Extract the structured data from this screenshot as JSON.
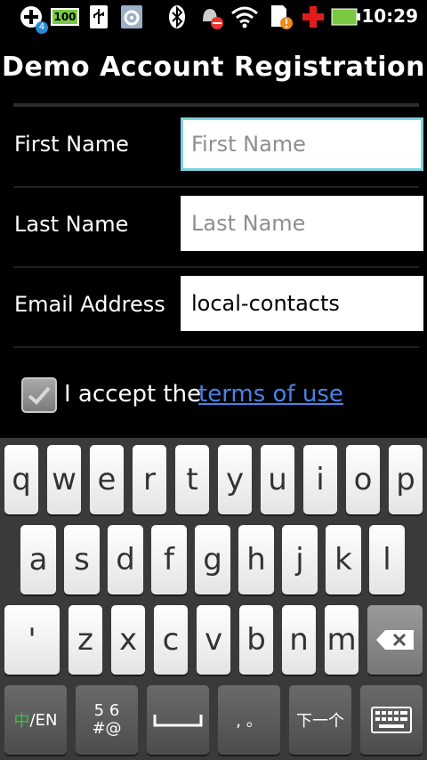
{
  "status_bar": {
    "icons": [
      "add-notification-icon",
      "battery-100-icon",
      "usb-icon",
      "settings-icon",
      "bluetooth-icon",
      "alarm-off-icon",
      "wifi-icon",
      "sd-card-alert-icon",
      "red-cross-icon",
      "battery-icon"
    ],
    "notification_count": "4",
    "battery_text": "100",
    "time": "10:29"
  },
  "title": "Demo Account Registration",
  "form": {
    "first_name": {
      "label": "First Name",
      "placeholder": "First Name",
      "value": ""
    },
    "last_name": {
      "label": "Last Name",
      "placeholder": "Last Name",
      "value": ""
    },
    "email": {
      "label": "Email Address",
      "placeholder": "",
      "value": "local-contacts"
    }
  },
  "terms": {
    "label": "I accept the",
    "link": "terms of use",
    "checked": true
  },
  "keyboard": {
    "row1": [
      "q",
      "w",
      "e",
      "r",
      "t",
      "y",
      "u",
      "i",
      "o",
      "p"
    ],
    "row2": [
      "a",
      "s",
      "d",
      "f",
      "g",
      "h",
      "j",
      "k",
      "l"
    ],
    "row3": [
      "'",
      "z",
      "x",
      "c",
      "v",
      "b",
      "n",
      "m"
    ],
    "lang_key": "/EN",
    "lang_glyph": "中",
    "sym_key_top": "5 6",
    "sym_key_bottom": "#@",
    "punct_key": ", 。",
    "next_key": "下一个"
  },
  "colors": {
    "link": "#4a82e5",
    "focus": "#7fd3df",
    "background": "#000000"
  }
}
